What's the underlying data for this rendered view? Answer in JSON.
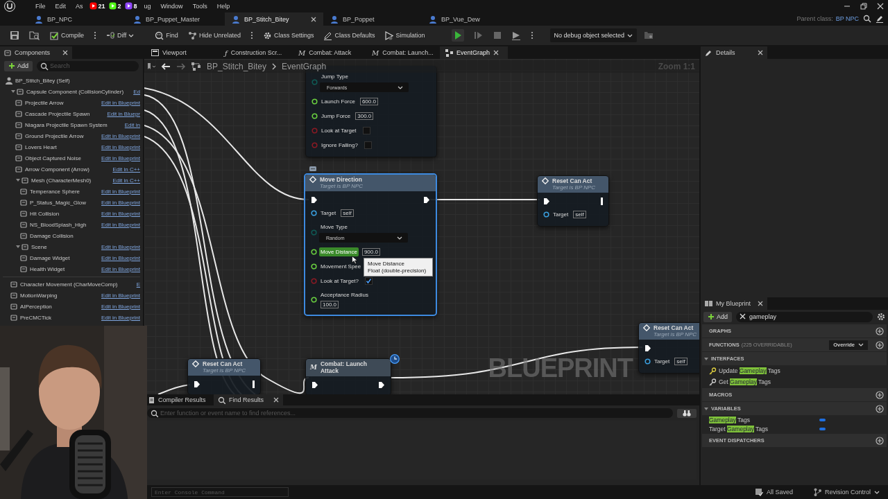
{
  "menu_bar": {
    "items": [
      {
        "kind": "menu",
        "label": "File"
      },
      {
        "kind": "menu",
        "label": "Edit"
      },
      {
        "kind": "menu",
        "label": "As"
      },
      {
        "kind": "counter",
        "color": "#ff0000",
        "count": "21"
      },
      {
        "kind": "counter",
        "color": "#53fc18",
        "count": "2"
      },
      {
        "kind": "counter",
        "color": "#9146ff",
        "count": "8"
      },
      {
        "kind": "menu",
        "label": "ug"
      },
      {
        "kind": "menu",
        "label": "Window"
      },
      {
        "kind": "menu",
        "label": "Tools"
      },
      {
        "kind": "menu",
        "label": "Help"
      }
    ]
  },
  "document_tabs": [
    {
      "label": "BP_NPC",
      "selected": false
    },
    {
      "label": "BP_Puppet_Master",
      "selected": false
    },
    {
      "label": "BP_Stitch_Bitey",
      "selected": true
    },
    {
      "label": "BP_Poppet",
      "selected": false
    },
    {
      "label": "BP_Vue_Dew",
      "selected": false
    }
  ],
  "parent_class": {
    "label": "Parent class:",
    "value": "BP NPC"
  },
  "toolbar": {
    "buttons": [
      {
        "label": "Compile",
        "options": true,
        "dropdown": false
      },
      {
        "label": "Diff",
        "options": false,
        "dropdown": true
      },
      {
        "label": "Find",
        "options": false,
        "dropdown": false
      },
      {
        "label": "Hide Unrelated",
        "options": true,
        "dropdown": false
      },
      {
        "label": "Class Settings",
        "options": false,
        "dropdown": false
      },
      {
        "label": "Class Defaults",
        "options": false,
        "dropdown": false
      },
      {
        "label": "Simulation",
        "options": false,
        "dropdown": false
      }
    ],
    "debug_object": {
      "value": "No debug object selected"
    }
  },
  "components": {
    "tab": "Components",
    "add": "Add",
    "search": {
      "placeholder": "Search"
    },
    "tree": [
      {
        "name": "BP_Stitch_Bitey (Self)",
        "children": [
          {
            "name": "Capsule Component (CollisionCylinder)",
            "link": "Ed",
            "expanded": true,
            "children": [
              {
                "name": "Projectile Arrow",
                "link": "Edit in Blueprint"
              },
              {
                "name": "Cascade Projectile Spawn",
                "link": "Edit in Bluepr"
              },
              {
                "name": "Niagara Projectile Spawn System",
                "link": "Edit in"
              },
              {
                "name": "Ground Projectile Arrow",
                "link": "Edit in Blueprint"
              },
              {
                "name": "Lovers Heart",
                "link": "Edit in Blueprint"
              },
              {
                "name": "Object Captured Noise",
                "link": "Edit in Blueprint"
              },
              {
                "name": "Arrow Component (Arrow)",
                "link": "Edit in C++"
              },
              {
                "name": "Mesh (CharacterMesh0)",
                "link": "Edit in C++",
                "expanded": true,
                "children": [
                  {
                    "name": "Temperance Sphere",
                    "link": "Edit in Blueprint"
                  },
                  {
                    "name": "P_Status_Magic_Glow",
                    "link": "Edit in Blueprint"
                  },
                  {
                    "name": "Hit Collision",
                    "link": "Edit in Blueprint"
                  },
                  {
                    "name": "NS_BloodSplash_High",
                    "link": "Edit in Blueprint"
                  },
                  {
                    "name": "Damage Collision"
                  }
                ]
              },
              {
                "name": "Scene",
                "link": "Edit in Blueprint",
                "expanded": true,
                "children": [
                  {
                    "name": "Damage Widget",
                    "link": "Edit in Blueprint"
                  },
                  {
                    "name": "Health Widget",
                    "link": "Edit in Blueprint"
                  }
                ]
              }
            ]
          }
        ]
      }
    ],
    "extra": [
      {
        "name": "Character Movement (CharMoveComp)",
        "link": "E"
      },
      {
        "name": "MotionWarping",
        "link": "Edit in Blueprint"
      },
      {
        "name": "AIPerception",
        "link": "Edit in Blueprint"
      },
      {
        "name": "PreCMCTick",
        "link": "Edit in Blueprint"
      }
    ]
  },
  "editor_tabs": [
    {
      "kind": "viewport",
      "label": "Viewport",
      "selected": false
    },
    {
      "kind": "glyph",
      "glyph": "ƒ",
      "label": "Construction Scr...",
      "selected": false
    },
    {
      "kind": "glyph",
      "glyph": "M",
      "label": "Combat: Attack",
      "selected": false
    },
    {
      "kind": "glyph",
      "glyph": "M",
      "label": "Combat: Launch...",
      "selected": false
    },
    {
      "kind": "graph",
      "label": "EventGraph",
      "selected": true
    }
  ],
  "graph": {
    "breadcrumb": [
      "BP_Stitch_Bitey",
      "EventGraph"
    ],
    "zoom": "Zoom 1:1",
    "watermark": "BLUEPRINT",
    "nodes": [
      {
        "kind": "function",
        "selected": false,
        "latent": false,
        "pins": [
          {
            "kind": "enum",
            "label": "Jump Type",
            "value": "Forwards"
          },
          {
            "kind": "float",
            "label": "Launch Force",
            "value": "600.0"
          },
          {
            "kind": "float",
            "label": "Jump Force",
            "value": "300.0"
          },
          {
            "kind": "bool",
            "label": "Look at Target",
            "checked": false
          },
          {
            "kind": "bool",
            "label": "Ignore Falling?",
            "checked": false
          }
        ]
      },
      {
        "kind": "function",
        "title": "Move Direction",
        "subtitle": "Target is BP NPC",
        "selected": true,
        "latent": false,
        "exec_in": true,
        "exec_out": true,
        "pins": [
          {
            "kind": "object",
            "label": "Target",
            "value": "self",
            "hovered": false
          },
          {
            "kind": "enum",
            "label": "Move Type",
            "value": "Random",
            "hovered": false
          },
          {
            "kind": "float",
            "label": "Move Distance",
            "value": "900.0",
            "hovered": true
          },
          {
            "kind": "float",
            "label": "Movement Spee",
            "hovered": false
          },
          {
            "kind": "bool",
            "label": "Look at Target?",
            "checked": true,
            "hovered": false
          },
          {
            "kind": "float_stacked",
            "label": "Acceptance Radius",
            "value": "100.0",
            "hovered": false
          }
        ]
      },
      {
        "kind": "function",
        "title": "Reset Can Act",
        "subtitle": "Target is BP NPC",
        "selected": false,
        "latent": false,
        "exec_in": true,
        "end_marker": true,
        "pins": [
          {
            "kind": "object",
            "label": "Target",
            "value": "self"
          }
        ]
      },
      {
        "kind": "function",
        "title": "Reset Can Act",
        "subtitle": "Target is BP NPC",
        "selected": false,
        "latent": false,
        "exec_in": true,
        "pins": [
          {
            "kind": "object",
            "label": "Target",
            "value": "self"
          }
        ]
      },
      {
        "kind": "function",
        "title": "Reset Can Act",
        "subtitle": "Target is BP NPC",
        "selected": false,
        "latent": false,
        "exec_in": true,
        "end_marker": true
      },
      {
        "kind": "macro",
        "glyph": "M",
        "title": "Combat: Launch Attack",
        "selected": false,
        "latent": true,
        "exec_in": true,
        "exec_out": true
      }
    ],
    "tooltip": {
      "title": "Move Distance",
      "type": "Float (double-precision)"
    }
  },
  "bottom_panel": {
    "tabs": [
      {
        "label": "Compiler Results",
        "selected": false
      },
      {
        "label": "Find Results",
        "selected": true
      }
    ],
    "search": {
      "placeholder": "Enter function or event name to find references..."
    }
  },
  "details": {
    "tab": "Details"
  },
  "my_blueprint": {
    "tab": "My Blueprint",
    "add": "Add",
    "search": {
      "value": "gameplay"
    },
    "sections": [
      {
        "title": "GRAPHS",
        "expanded": false,
        "add": true
      },
      {
        "title": "FUNCTIONS",
        "note": "(225 OVERRIDABLE)",
        "dropdown": "Override",
        "expanded": false,
        "add": true
      },
      {
        "title": "INTERFACES",
        "expanded": true,
        "add": false,
        "items": [
          {
            "kind": "interface",
            "prefix": "Update ",
            "match": "Gameplay",
            "suffix": " Tags"
          },
          {
            "kind": "interface",
            "prefix": "Get ",
            "match": "Gameplay",
            "suffix": " Tags"
          }
        ]
      },
      {
        "title": "MACROS",
        "expanded": false,
        "add": true
      },
      {
        "title": "VARIABLES",
        "expanded": true,
        "add": true,
        "items": [
          {
            "kind": "variable",
            "match": "Gameplay",
            "suffix": " Tags",
            "color": "#1f6fe0"
          },
          {
            "kind": "variable",
            "prefix": "Target ",
            "match": "Gameplay",
            "suffix": " Tags",
            "color": "#1f6fe0"
          }
        ]
      },
      {
        "title": "EVENT DISPATCHERS",
        "expanded": false,
        "add": true
      }
    ]
  },
  "status_bar": {
    "console": {
      "placeholder": "Enter Console Command"
    },
    "items": [
      "All Saved",
      "Revision Control"
    ]
  }
}
